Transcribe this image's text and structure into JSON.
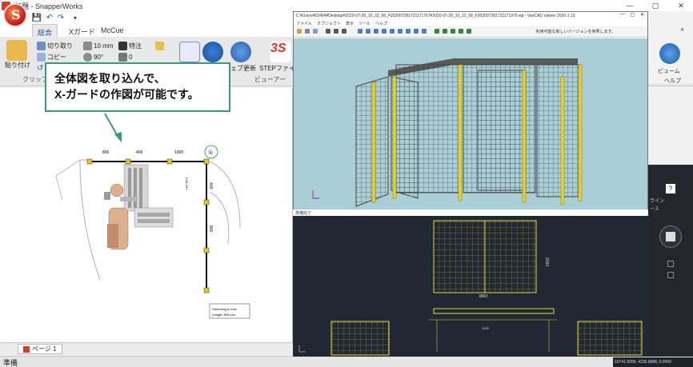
{
  "window": {
    "title": "無題 - SnapperWorks",
    "minimize": "—",
    "maximize": "▢",
    "close": "✕"
  },
  "quick_access": {
    "save": "💾",
    "undo": "↶",
    "redo": "↷",
    "more": "▾"
  },
  "tabs": [
    {
      "label": "総合",
      "active": true
    },
    {
      "label": "Xガード",
      "active": false
    },
    {
      "label": "McCue",
      "active": false
    }
  ],
  "ribbon": {
    "paste": "貼り付け",
    "cut": "切り取り",
    "copy": "コピー",
    "clipboard_group": "クリップボ",
    "length": "10 mm",
    "angle": "90°",
    "special": "特注",
    "zero": "0",
    "web_update": "ェブ更新",
    "step_file": "STEPファイル",
    "viewer_group": "ビューアー"
  },
  "callout": {
    "line1": "全体図を取り込んで、",
    "line2": "X-ガードの作図が可能です。"
  },
  "drawing": {
    "dim_800": "800",
    "dim_400": "400",
    "dim_1000": "1000",
    "dim_800_right": "800",
    "dim_400_side": "400",
    "marker": "①",
    "note_line1": "Stretching is now",
    "note_line2": "Length: 800 mm",
    "labels": "LXX-25+\nD1X-XXX-55A"
  },
  "page_tab": {
    "label": "ページ 1"
  },
  "status": {
    "text": "準備"
  },
  "varicad": {
    "title": "C:¥Users¥02464¥Desktop¥2020-07-28_10_22_58_F202007281721171767¥2020-07-28_10_22_58_F202007281721171976.stp - VariCAD Viewer 2020-1.10",
    "menu": [
      "ファイル",
      "オブジェクト",
      "表示",
      "ツール",
      "ヘルプ"
    ],
    "right_note": "利用可能な新しいバージョンを参照します。",
    "status": "準備完了",
    "minimize": "—",
    "maximize": "▢",
    "close": "✕"
  },
  "cad_view": {
    "dim_top": "2000",
    "dim_mid": "1000",
    "dim_bottom": "3890",
    "coordinates": "10741.9059, 4236.6888, 0.0000"
  },
  "right_ribbon": {
    "label1": "ビューム",
    "label2": "ヘルプ",
    "label3": "ライン",
    "label4": "ース"
  }
}
